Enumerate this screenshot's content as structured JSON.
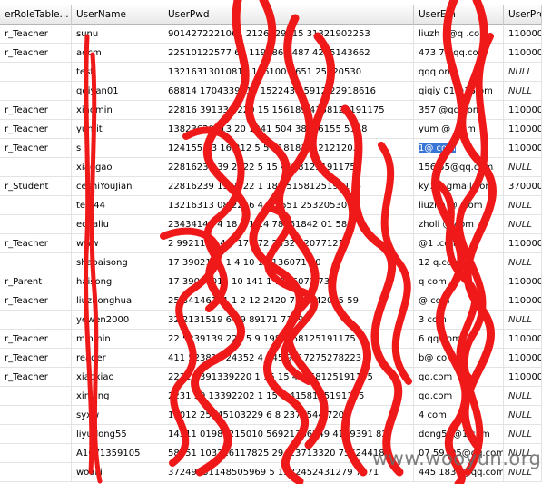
{
  "columns": [
    "erRoleTable...",
    "UserName",
    "UserPwd",
    "UserEm",
    "UserPro"
  ],
  "rows": [
    [
      "r_Teacher",
      "sunu",
      "9014272221061   2126829915   31321902253",
      "liuzh   a@q   .com",
      "110000"
    ],
    [
      "r_Teacher",
      "adcm",
      "22510122577   68   1190862   487   4215143662",
      "473   74   qq.com",
      "110000"
    ],
    [
      "",
      "test",
      "13216313010811     146100   3651   25320530",
      "qqq   om",
      "NULL"
    ],
    [
      "",
      "qqiyan01",
      "68814   1704339210   152243   55912   22918616",
      "qiqiy   01@16   om",
      "NULL"
    ],
    [
      "r_Teacher",
      "xiaomin",
      "22816   391339   220   15   156189   4158125191175",
      "357   @qq.com",
      "110000"
    ],
    [
      "r_Teacher",
      "yumit",
      "13823620913   20   1341   504   38236155 5138",
      "yum   @   .com",
      "110000"
    ],
    [
      "r_Teacher",
      "s",
      "124155   43   16   212   5   5   11818191212120...",
      "1@   com",
      "110000"
    ],
    [
      "",
      "xiaogao",
      "22816239   39   2022   5   15   4158125191175",
      "156   55@qq.com",
      "NULL"
    ],
    [
      "r_Student",
      "ceshiYouJian",
      "22816239   13   2022   1   189   5158125191175",
      "ky.z   a   gmail   com",
      "370000"
    ],
    [
      "",
      "test44",
      "13216313   08   2256   4   1   3651   25320530",
      "liuzho   @   .com",
      "NULL"
    ],
    [
      "",
      "echaliu",
      "23434146   4   18   0   1   24   78561842 01 589",
      "zholi   @   com",
      "NULL"
    ],
    [
      "r_Teacher",
      "www",
      "2   9921103   4   5   17   172   2432   72077121",
      "   @1   .com",
      "110000"
    ],
    [
      "",
      "shaoaisong",
      "17   3902101   1   4   10   1   1136071   70",
      "   12   q.com",
      "NULL"
    ],
    [
      "r_Parent",
      "haisong",
      "17   39021011   10   141   1   1136071   73",
      "   q   com",
      "110000"
    ],
    [
      "r_Teacher",
      "liuzhonghua",
      "25   34146131   1   2   12   2420   76   1842015   59",
      "   @   com",
      "110000"
    ],
    [
      "",
      "yewen2000",
      "32   2131519   6   49   89171   7149",
      "   3   com",
      "NULL"
    ],
    [
      "r_Teacher",
      "minmin",
      "22   5239139   220   5   9   1984158125191175",
      "   6   qq.com",
      "110000"
    ],
    [
      "r_Teacher",
      "reader",
      "411   523813   24352   4   345   9817275278223",
      "   b@   com",
      "110000"
    ],
    [
      "r_Teacher",
      "xiaoxiao",
      "2231   2391339220   1   15   15   41158125191175",
      "   qq.com",
      "110000"
    ],
    [
      "",
      "xinying",
      "2231   39   13392202   1   15   1   4158125191175",
      "   qq.com",
      "NULL"
    ],
    [
      "",
      "syxw",
      "19012   25245103229   6   8   2371544   7204",
      "   4   com",
      "NULL"
    ],
    [
      "",
      "liyudong55",
      "14511   01985215010   56921386249   4109391   82",
      "   dong55@1   com",
      "NULL"
    ],
    [
      "",
      "A1071359105",
      "58851   103216117825   29423713320   75624418",
      "   07   59105@qq.com",
      "NULL"
    ],
    [
      "",
      "woaili",
      "37249231148505969   5   1332452431279   7771",
      "445   1830@qq.com",
      "NULL"
    ]
  ],
  "selected_cell_text": "1@   com",
  "watermark": "www.wooyun.org",
  "colors": {
    "scribble": "#f01919",
    "selection": "#3875d7",
    "header_bg": "#ececec"
  }
}
